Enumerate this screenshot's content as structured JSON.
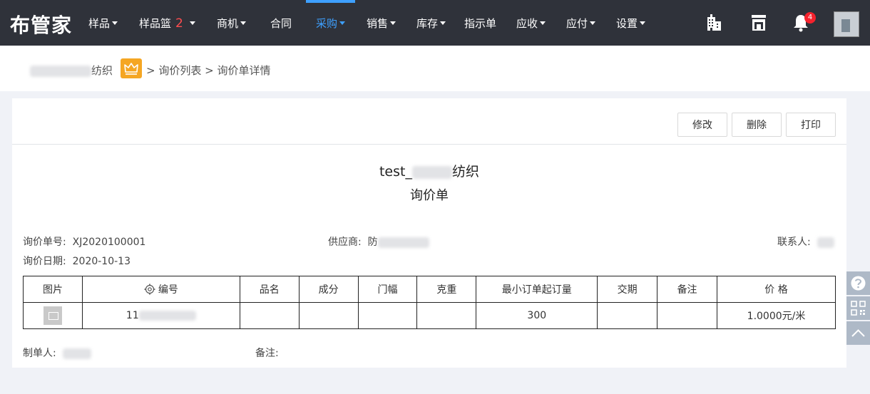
{
  "app": {
    "logo": "布管家"
  },
  "nav": {
    "items": [
      {
        "label": "样品",
        "caret": true
      },
      {
        "label": "样品篮",
        "count": "2",
        "caret": true
      },
      {
        "label": "商机",
        "caret": true
      },
      {
        "label": "合同",
        "caret": false
      },
      {
        "label": "采购",
        "caret": true,
        "active": true
      },
      {
        "label": "销售",
        "caret": true
      },
      {
        "label": "库存",
        "caret": true
      },
      {
        "label": "指示单",
        "caret": false
      },
      {
        "label": "应收",
        "caret": true
      },
      {
        "label": "应付",
        "caret": true
      },
      {
        "label": "设置",
        "caret": true
      }
    ],
    "notification_count": "4",
    "active_color": "#3ea0ff"
  },
  "breadcrumb": {
    "company_suffix": "纺织",
    "path": "> 询价列表 > 询价单详情"
  },
  "toolbar": {
    "edit_label": "修改",
    "delete_label": "删除",
    "print_label": "打印"
  },
  "document": {
    "company_prefix": "test_",
    "company_suffix": "纺织",
    "title": "询价单",
    "number_label": "询价单号:",
    "number": "XJ2020100001",
    "date_label": "询价日期:",
    "date": "2020-10-13",
    "supplier_label": "供应商:",
    "supplier_prefix": "防",
    "contact_label": "联系人:",
    "creator_label": "制单人:",
    "remark_label": "备注:"
  },
  "table": {
    "headers": [
      "图片",
      "编号",
      "品名",
      "成分",
      "门幅",
      "克重",
      "最小订单起订量",
      "交期",
      "备注",
      "价 格"
    ],
    "rows": [
      {
        "code_prefix": "11",
        "name": "",
        "composition": "",
        "width": "",
        "weight": "",
        "moq": "300",
        "delivery": "",
        "remark": "",
        "price": "1.0000元/米"
      }
    ]
  }
}
